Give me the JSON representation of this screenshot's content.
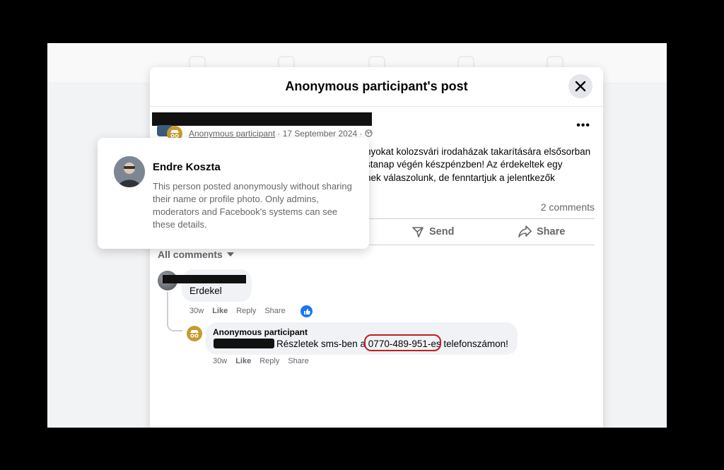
{
  "dialog": {
    "title": "Anonymous participant's post"
  },
  "post": {
    "author": "Anonymous participant",
    "date": "17 September 2024",
    "separator": " · ",
    "text_lines": [
      "nyokat kolozsvári irodaházak takarítására elsősorban",
      "stanap végén készpénzben! Az érdekeltek egy",
      "nek válaszolunk, de fenntartjuk a jelentkezők"
    ],
    "more_label": "•••",
    "comments_count": "2 comments",
    "actions": {
      "send": "Send",
      "share": "Share"
    }
  },
  "all_comments_label": "All comments",
  "comments": [
    {
      "text": "Erdekel",
      "time": "30w",
      "like": "Like",
      "reply": "Reply",
      "share": "Share"
    },
    {
      "author": "Anonymous participant",
      "text": "Részletek sms-ben a 0770-489-951-es telefonszámon!",
      "time": "30w",
      "like": "Like",
      "reply": "Reply",
      "share": "Share"
    }
  ],
  "hover_card": {
    "name": "Endre Koszta",
    "description": "This person posted anonymously without sharing their name or profile photo. Only admins, moderators and Facebook's systems can see these details."
  },
  "colors": {
    "accent": "#1877f2",
    "annotation": "#c0201a",
    "anonymous_badge": "#c89a2f"
  }
}
